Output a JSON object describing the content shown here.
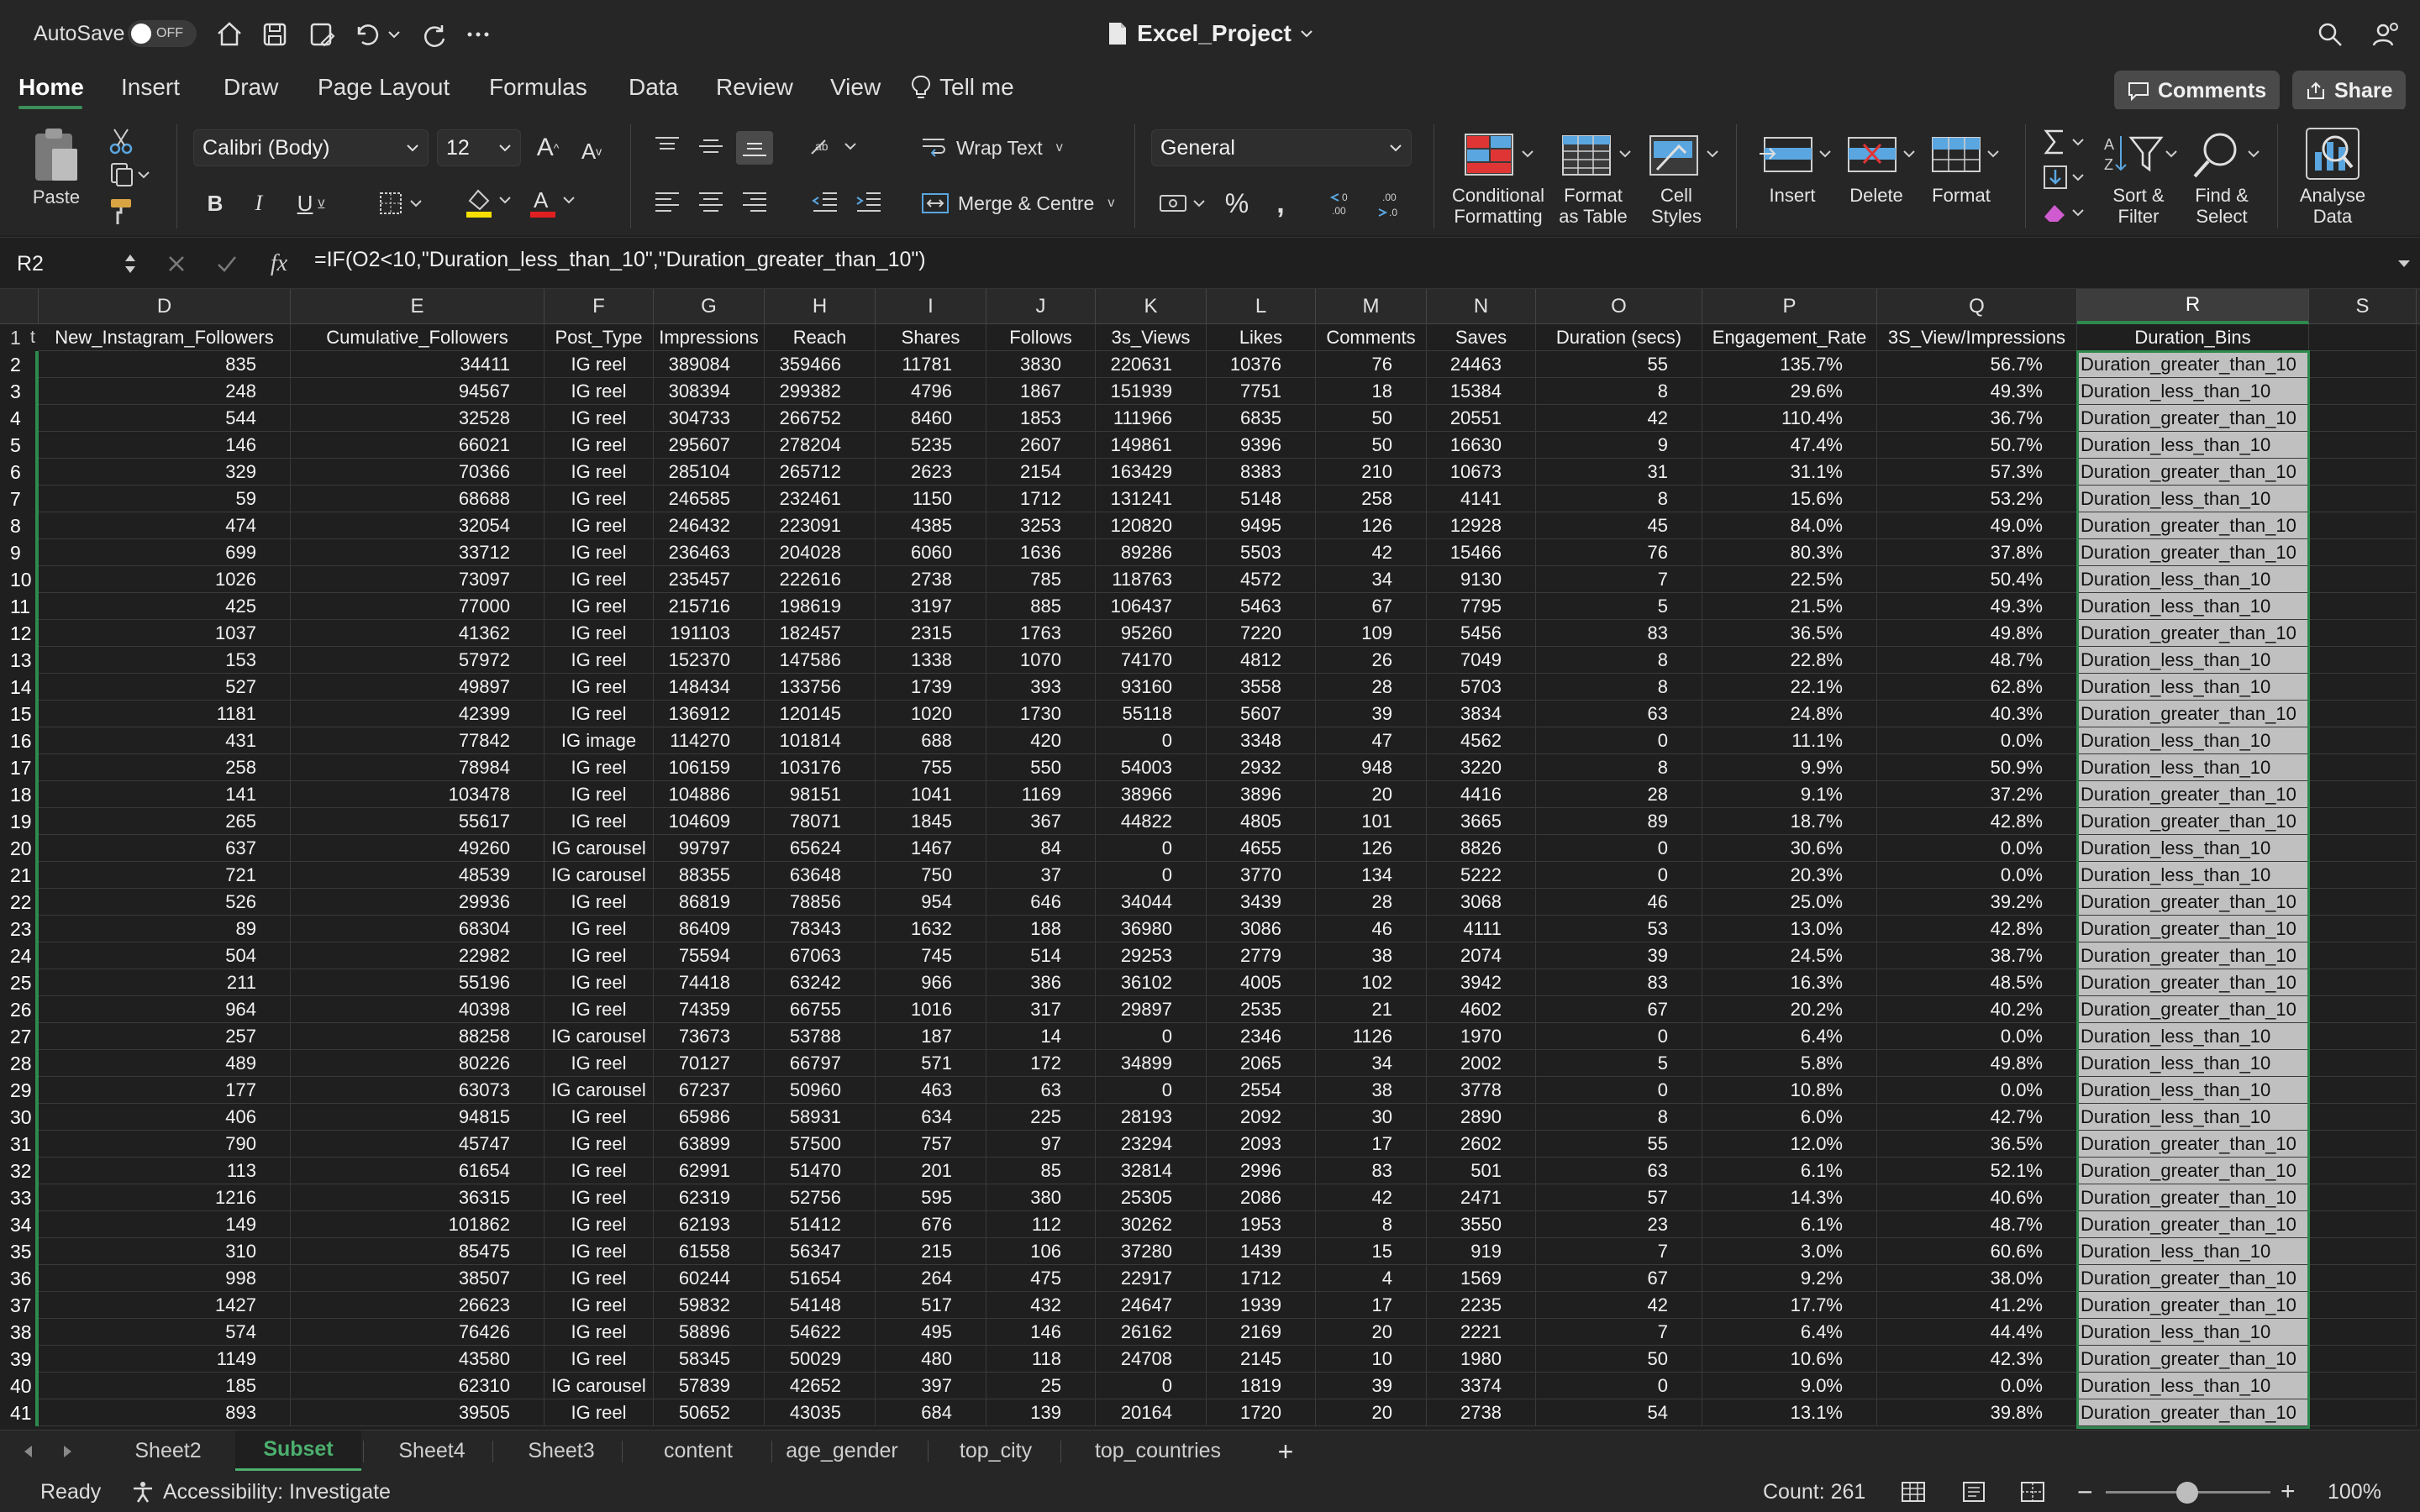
{
  "titlebar": {
    "autosave_label": "AutoSave",
    "autosave_state": "OFF",
    "document_title": "Excel_Project"
  },
  "tabs": {
    "items": [
      "Home",
      "Insert",
      "Draw",
      "Page Layout",
      "Formulas",
      "Data",
      "Review",
      "View"
    ],
    "tell_me": "Tell me",
    "comments": "Comments",
    "share": "Share"
  },
  "ribbon": {
    "paste": "Paste",
    "font_name": "Calibri (Body)",
    "font_size": "12",
    "wrap_text": "Wrap Text",
    "merge_centre": "Merge & Centre",
    "number_format": "General",
    "conditional_formatting": [
      "Conditional",
      "Formatting"
    ],
    "format_as_table": [
      "Format",
      "as Table"
    ],
    "cell_styles": [
      "Cell",
      "Styles"
    ],
    "insert": "Insert",
    "delete": "Delete",
    "format": "Format",
    "sort_filter": [
      "Sort &",
      "Filter"
    ],
    "find_select": [
      "Find &",
      "Select"
    ],
    "analyse_data": [
      "Analyse",
      "Data"
    ]
  },
  "formula_bar": {
    "name_box": "R2",
    "formula": "=IF(O2<10,\"Duration_less_than_10\",\"Duration_greater_than_10\")"
  },
  "grid": {
    "columns": [
      "D",
      "E",
      "F",
      "G",
      "H",
      "I",
      "J",
      "K",
      "L",
      "M",
      "N",
      "O",
      "P",
      "Q",
      "R",
      "S"
    ],
    "row1_partial": "t",
    "header": [
      "New_Instagram_Followers",
      "Cumulative_Followers",
      "Post_Type",
      "Impressions",
      "Reach",
      "Shares",
      "Follows",
      "3s_Views",
      "Likes",
      "Comments",
      "Saves",
      "Duration (secs)",
      "Engagement_Rate",
      "3S_View/Impressions",
      "Duration_Bins",
      ""
    ],
    "rows": [
      [
        "835",
        "34411",
        "IG reel",
        "389084",
        "359466",
        "11781",
        "3830",
        "220631",
        "10376",
        "76",
        "24463",
        "55",
        "135.7%",
        "56.7%",
        "Duration_greater_than_10"
      ],
      [
        "248",
        "94567",
        "IG reel",
        "308394",
        "299382",
        "4796",
        "1867",
        "151939",
        "7751",
        "18",
        "15384",
        "8",
        "29.6%",
        "49.3%",
        "Duration_less_than_10"
      ],
      [
        "544",
        "32528",
        "IG reel",
        "304733",
        "266752",
        "8460",
        "1853",
        "111966",
        "6835",
        "50",
        "20551",
        "42",
        "110.4%",
        "36.7%",
        "Duration_greater_than_10"
      ],
      [
        "146",
        "66021",
        "IG reel",
        "295607",
        "278204",
        "5235",
        "2607",
        "149861",
        "9396",
        "50",
        "16630",
        "9",
        "47.4%",
        "50.7%",
        "Duration_less_than_10"
      ],
      [
        "329",
        "70366",
        "IG reel",
        "285104",
        "265712",
        "2623",
        "2154",
        "163429",
        "8383",
        "210",
        "10673",
        "31",
        "31.1%",
        "57.3%",
        "Duration_greater_than_10"
      ],
      [
        "59",
        "68688",
        "IG reel",
        "246585",
        "232461",
        "1150",
        "1712",
        "131241",
        "5148",
        "258",
        "4141",
        "8",
        "15.6%",
        "53.2%",
        "Duration_less_than_10"
      ],
      [
        "474",
        "32054",
        "IG reel",
        "246432",
        "223091",
        "4385",
        "3253",
        "120820",
        "9495",
        "126",
        "12928",
        "45",
        "84.0%",
        "49.0%",
        "Duration_greater_than_10"
      ],
      [
        "699",
        "33712",
        "IG reel",
        "236463",
        "204028",
        "6060",
        "1636",
        "89286",
        "5503",
        "42",
        "15466",
        "76",
        "80.3%",
        "37.8%",
        "Duration_greater_than_10"
      ],
      [
        "1026",
        "73097",
        "IG reel",
        "235457",
        "222616",
        "2738",
        "785",
        "118763",
        "4572",
        "34",
        "9130",
        "7",
        "22.5%",
        "50.4%",
        "Duration_less_than_10"
      ],
      [
        "425",
        "77000",
        "IG reel",
        "215716",
        "198619",
        "3197",
        "885",
        "106437",
        "5463",
        "67",
        "7795",
        "5",
        "21.5%",
        "49.3%",
        "Duration_less_than_10"
      ],
      [
        "1037",
        "41362",
        "IG reel",
        "191103",
        "182457",
        "2315",
        "1763",
        "95260",
        "7220",
        "109",
        "5456",
        "83",
        "36.5%",
        "49.8%",
        "Duration_greater_than_10"
      ],
      [
        "153",
        "57972",
        "IG reel",
        "152370",
        "147586",
        "1338",
        "1070",
        "74170",
        "4812",
        "26",
        "7049",
        "8",
        "22.8%",
        "48.7%",
        "Duration_less_than_10"
      ],
      [
        "527",
        "49897",
        "IG reel",
        "148434",
        "133756",
        "1739",
        "393",
        "93160",
        "3558",
        "28",
        "5703",
        "8",
        "22.1%",
        "62.8%",
        "Duration_less_than_10"
      ],
      [
        "1181",
        "42399",
        "IG reel",
        "136912",
        "120145",
        "1020",
        "1730",
        "55118",
        "5607",
        "39",
        "3834",
        "63",
        "24.8%",
        "40.3%",
        "Duration_greater_than_10"
      ],
      [
        "431",
        "77842",
        "IG image",
        "114270",
        "101814",
        "688",
        "420",
        "0",
        "3348",
        "47",
        "4562",
        "0",
        "11.1%",
        "0.0%",
        "Duration_less_than_10"
      ],
      [
        "258",
        "78984",
        "IG reel",
        "106159",
        "103176",
        "755",
        "550",
        "54003",
        "2932",
        "948",
        "3220",
        "8",
        "9.9%",
        "50.9%",
        "Duration_less_than_10"
      ],
      [
        "141",
        "103478",
        "IG reel",
        "104886",
        "98151",
        "1041",
        "1169",
        "38966",
        "3896",
        "20",
        "4416",
        "28",
        "9.1%",
        "37.2%",
        "Duration_greater_than_10"
      ],
      [
        "265",
        "55617",
        "IG reel",
        "104609",
        "78071",
        "1845",
        "367",
        "44822",
        "4805",
        "101",
        "3665",
        "89",
        "18.7%",
        "42.8%",
        "Duration_greater_than_10"
      ],
      [
        "637",
        "49260",
        "IG carousel",
        "99797",
        "65624",
        "1467",
        "84",
        "0",
        "4655",
        "126",
        "8826",
        "0",
        "30.6%",
        "0.0%",
        "Duration_less_than_10"
      ],
      [
        "721",
        "48539",
        "IG carousel",
        "88355",
        "63648",
        "750",
        "37",
        "0",
        "3770",
        "134",
        "5222",
        "0",
        "20.3%",
        "0.0%",
        "Duration_less_than_10"
      ],
      [
        "526",
        "29936",
        "IG reel",
        "86819",
        "78856",
        "954",
        "646",
        "34044",
        "3439",
        "28",
        "3068",
        "46",
        "25.0%",
        "39.2%",
        "Duration_greater_than_10"
      ],
      [
        "89",
        "68304",
        "IG reel",
        "86409",
        "78343",
        "1632",
        "188",
        "36980",
        "3086",
        "46",
        "4111",
        "53",
        "13.0%",
        "42.8%",
        "Duration_greater_than_10"
      ],
      [
        "504",
        "22982",
        "IG reel",
        "75594",
        "67063",
        "745",
        "514",
        "29253",
        "2779",
        "38",
        "2074",
        "39",
        "24.5%",
        "38.7%",
        "Duration_greater_than_10"
      ],
      [
        "211",
        "55196",
        "IG reel",
        "74418",
        "63242",
        "966",
        "386",
        "36102",
        "4005",
        "102",
        "3942",
        "83",
        "16.3%",
        "48.5%",
        "Duration_greater_than_10"
      ],
      [
        "964",
        "40398",
        "IG reel",
        "74359",
        "66755",
        "1016",
        "317",
        "29897",
        "2535",
        "21",
        "4602",
        "67",
        "20.2%",
        "40.2%",
        "Duration_greater_than_10"
      ],
      [
        "257",
        "88258",
        "IG carousel",
        "73673",
        "53788",
        "187",
        "14",
        "0",
        "2346",
        "1126",
        "1970",
        "0",
        "6.4%",
        "0.0%",
        "Duration_less_than_10"
      ],
      [
        "489",
        "80226",
        "IG reel",
        "70127",
        "66797",
        "571",
        "172",
        "34899",
        "2065",
        "34",
        "2002",
        "5",
        "5.8%",
        "49.8%",
        "Duration_less_than_10"
      ],
      [
        "177",
        "63073",
        "IG carousel",
        "67237",
        "50960",
        "463",
        "63",
        "0",
        "2554",
        "38",
        "3778",
        "0",
        "10.8%",
        "0.0%",
        "Duration_less_than_10"
      ],
      [
        "406",
        "94815",
        "IG reel",
        "65986",
        "58931",
        "634",
        "225",
        "28193",
        "2092",
        "30",
        "2890",
        "8",
        "6.0%",
        "42.7%",
        "Duration_less_than_10"
      ],
      [
        "790",
        "45747",
        "IG reel",
        "63899",
        "57500",
        "757",
        "97",
        "23294",
        "2093",
        "17",
        "2602",
        "55",
        "12.0%",
        "36.5%",
        "Duration_greater_than_10"
      ],
      [
        "113",
        "61654",
        "IG reel",
        "62991",
        "51470",
        "201",
        "85",
        "32814",
        "2996",
        "83",
        "501",
        "63",
        "6.1%",
        "52.1%",
        "Duration_greater_than_10"
      ],
      [
        "1216",
        "36315",
        "IG reel",
        "62319",
        "52756",
        "595",
        "380",
        "25305",
        "2086",
        "42",
        "2471",
        "57",
        "14.3%",
        "40.6%",
        "Duration_greater_than_10"
      ],
      [
        "149",
        "101862",
        "IG reel",
        "62193",
        "51412",
        "676",
        "112",
        "30262",
        "1953",
        "8",
        "3550",
        "23",
        "6.1%",
        "48.7%",
        "Duration_greater_than_10"
      ],
      [
        "310",
        "85475",
        "IG reel",
        "61558",
        "56347",
        "215",
        "106",
        "37280",
        "1439",
        "15",
        "919",
        "7",
        "3.0%",
        "60.6%",
        "Duration_less_than_10"
      ],
      [
        "998",
        "38507",
        "IG reel",
        "60244",
        "51654",
        "264",
        "475",
        "22917",
        "1712",
        "4",
        "1569",
        "67",
        "9.2%",
        "38.0%",
        "Duration_greater_than_10"
      ],
      [
        "1427",
        "26623",
        "IG reel",
        "59832",
        "54148",
        "517",
        "432",
        "24647",
        "1939",
        "17",
        "2235",
        "42",
        "17.7%",
        "41.2%",
        "Duration_greater_than_10"
      ],
      [
        "574",
        "76426",
        "IG reel",
        "58896",
        "54622",
        "495",
        "146",
        "26162",
        "2169",
        "20",
        "2221",
        "7",
        "6.4%",
        "44.4%",
        "Duration_less_than_10"
      ],
      [
        "1149",
        "43580",
        "IG reel",
        "58345",
        "50029",
        "480",
        "118",
        "24708",
        "2145",
        "10",
        "1980",
        "50",
        "10.6%",
        "42.3%",
        "Duration_greater_than_10"
      ],
      [
        "185",
        "62310",
        "IG carousel",
        "57839",
        "42652",
        "397",
        "25",
        "0",
        "1819",
        "39",
        "3374",
        "0",
        "9.0%",
        "0.0%",
        "Duration_less_than_10"
      ],
      [
        "893",
        "39505",
        "IG reel",
        "50652",
        "43035",
        "684",
        "139",
        "20164",
        "1720",
        "20",
        "2738",
        "54",
        "13.1%",
        "39.8%",
        "Duration_greater_than_10"
      ]
    ]
  },
  "sheets": {
    "tabs": [
      "Sheet2",
      "Subset",
      "Sheet4",
      "Sheet3",
      "content",
      "age_gender",
      "top_city",
      "top_countries"
    ],
    "active": "Subset"
  },
  "status": {
    "ready": "Ready",
    "accessibility": "Accessibility: Investigate",
    "count": "Count: 261",
    "zoom": "100%"
  },
  "colors": {
    "accent": "#2e8a4e",
    "background": "#1f1f1f",
    "selection_fill": "#c0c0c0"
  }
}
